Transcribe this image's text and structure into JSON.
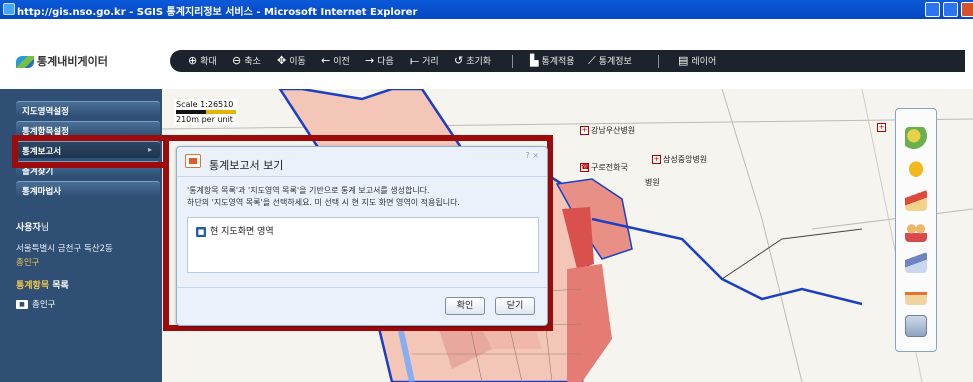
{
  "window": {
    "title": "http://gis.nso.go.kr - SGIS 통계지리정보 서비스 - Microsoft Internet Explorer"
  },
  "header": {
    "logo": "통계내비게이터"
  },
  "toolbar": {
    "zoom_in": "확대",
    "zoom_out": "축소",
    "pan": "이동",
    "prev": "이전",
    "next": "다음",
    "distance": "거리",
    "reset": "초기화",
    "apply_stats": "통계적용",
    "stats_info": "통계정보",
    "layer": "레이어"
  },
  "sidebar": {
    "items": [
      {
        "label": "지도영역설정"
      },
      {
        "label": "통계항목설정"
      },
      {
        "label": "통계보고서"
      },
      {
        "label": "즐겨찾기"
      },
      {
        "label": "통계마법사"
      }
    ],
    "user": {
      "label": "사용자",
      "suffix": "님",
      "address": "서울특별시 금천구 독산2동",
      "area": "총인구"
    },
    "stat_list": {
      "title_highlight": "통계항목",
      "title_rest": " 목록",
      "items": [
        "총인구"
      ]
    }
  },
  "map": {
    "scale_text": "Scale 1:26510",
    "unit_text": "210m per unit",
    "pois": [
      "강남우산병원",
      "구로전화국",
      "삼성중앙병원",
      "병원"
    ]
  },
  "dialog": {
    "title": "통계보고서 보기",
    "controls": "? ×",
    "desc_line1": "'통계항목 목록'과 '지도영역 목록'을 기반으로 통계 보고서를 생성합니다.",
    "desc_line2": "하단의 '지도영역 목록'을 선택하세요. 미 선택 시 현 지도 화면 영역이 적용됩니다.",
    "option": "현 지도화면 영역",
    "confirm": "확인",
    "close": "닫기"
  },
  "colors": {
    "sidebar_bg": "#2f5074",
    "toolbar_bg": "#1d232c",
    "highlight_frame": "#9e0b0b",
    "accent_yellow": "#f0c850"
  }
}
